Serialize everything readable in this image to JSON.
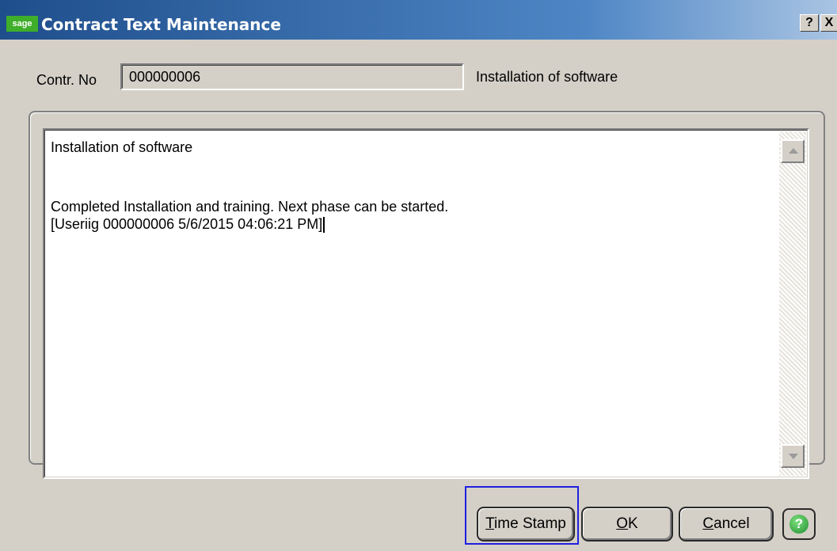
{
  "window": {
    "title": "Contract Text Maintenance",
    "logo_text": "sage",
    "help_label": "?",
    "close_label": "X"
  },
  "form": {
    "contract_label": "Contr. No",
    "contract_value": "000000006",
    "description": "Installation of software"
  },
  "text_area": {
    "lines": [
      "Installation of software",
      "",
      "Completed Installation and training. Next phase can be started.",
      "[Useriig 000000006 5/6/2015 04:06:21 PM]"
    ]
  },
  "buttons": {
    "time_stamp_mnemonic": "T",
    "time_stamp_rest": "ime Stamp",
    "ok_mnemonic": "O",
    "ok_rest": "K",
    "cancel_mnemonic": "C",
    "cancel_rest": "ancel",
    "help_glyph": "?"
  },
  "colors": {
    "title_bar": "#1f4e8c",
    "highlight": "#2020e0",
    "help_icon": "#1e8f2e"
  }
}
